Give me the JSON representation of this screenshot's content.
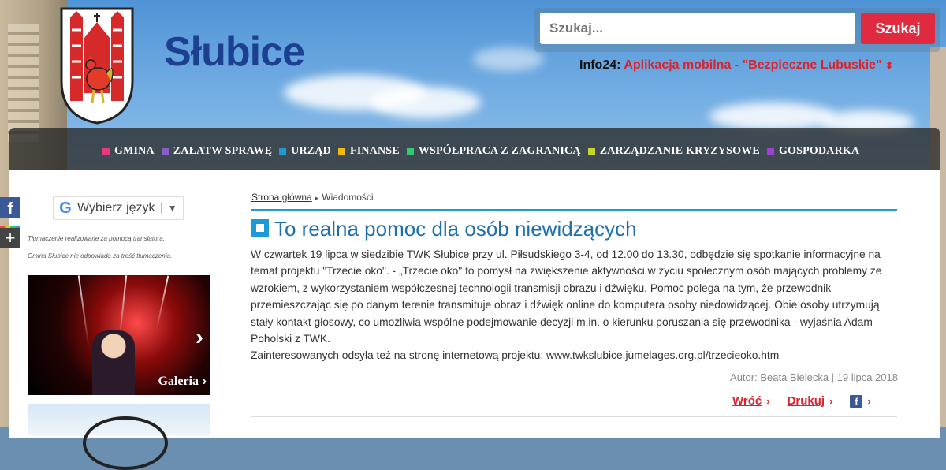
{
  "header": {
    "brand": "Słubice",
    "search": {
      "placeholder": "Szukaj...",
      "button": "Szukaj"
    },
    "ticker": {
      "label": "Info24:",
      "text": "Aplikacja mobilna - \"Bezpieczne Lubuskie\""
    }
  },
  "nav": {
    "items": [
      {
        "label": "GMINA",
        "color": "#e8397a"
      },
      {
        "label": "ZAŁATW SPRAWĘ",
        "color": "#8b5cc6"
      },
      {
        "label": "URZĄD",
        "color": "#1e9ad6"
      },
      {
        "label": "FINANSE",
        "color": "#f2b90f"
      },
      {
        "label": "WSPÓŁPRACA Z ZAGRANICĄ",
        "color": "#2ecc71"
      },
      {
        "label": "ZARZĄDZANIE KRYZYSOWE",
        "color": "#c8d52b"
      },
      {
        "label": "GOSPODARKA",
        "color": "#a23fd4"
      }
    ]
  },
  "sidebar": {
    "language": {
      "label": "Wybierz język",
      "google_mark": "G"
    },
    "translation_note_1": "Tłumaczenie realizowane za pomocą translatora,",
    "translation_note_2": "Gmina Słubice nie odpowiada za treść tłumaczenia.",
    "gallery_label": "Galeria"
  },
  "article": {
    "breadcrumb": {
      "home": "Strona główna",
      "current": "Wiadomości"
    },
    "title": "To realna pomoc dla osób niewidzących",
    "paragraph_1": "W czwartek 19 lipca w siedzibie TWK Słubice przy ul. Piłsudskiego 3-4, od 12.00 do 13.30, odbędzie się spotkanie informacyjne na temat projektu \"Trzecie oko\". - „Trzecie oko\" to pomysł na zwiększenie aktywności w życiu społecznym osób mających problemy ze wzrokiem, z wykorzystaniem współczesnej technologii transmisji obrazu i dźwięku. Pomoc polega na tym, że przewodnik przemieszczając się po danym terenie transmituje obraz i dźwięk online do komputera osoby niedowidzącej. Obie osoby utrzymują stały kontakt głosowy, co umożliwia wspólne podejmowanie decyzji m.in. o kierunku poruszania się przewodnika - wyjaśnia Adam Poholski z TWK.",
    "paragraph_2": "Zainteresowanych odsyła też na stronę internetową projektu: www.twkslubice.jumelages.org.pl/trzecieoko.htm",
    "meta": "Autor: Beata Bielecka | 19 lipca 2018",
    "actions": {
      "back": "Wróć",
      "print": "Drukuj",
      "fb": "f"
    }
  },
  "social": {
    "facebook": "f",
    "share": "+"
  },
  "colors": {
    "brand_blue": "#1c3f8f",
    "accent_blue": "#1e9ad6",
    "red": "#d9232e",
    "search_red": "#e02a3f"
  }
}
